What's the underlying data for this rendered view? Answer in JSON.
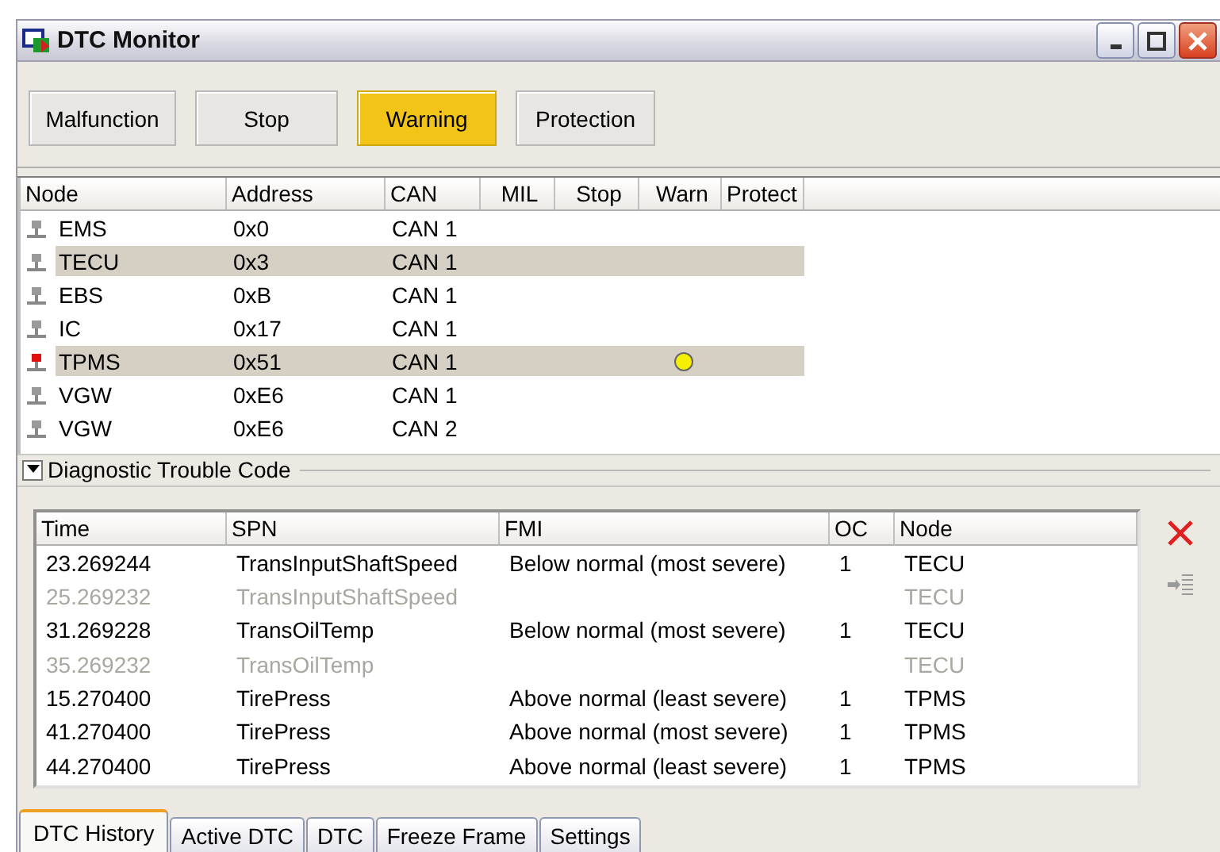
{
  "window": {
    "title": "DTC Monitor"
  },
  "status_buttons": [
    {
      "label": "Malfunction",
      "active": false
    },
    {
      "label": "Stop",
      "active": false
    },
    {
      "label": "Warning",
      "active": true
    },
    {
      "label": "Protection",
      "active": false
    }
  ],
  "nodes": {
    "columns": [
      "Node",
      "Address",
      "CAN",
      "MIL",
      "Stop",
      "Warn",
      "Protect"
    ],
    "rows": [
      {
        "node": "EMS",
        "address": "0x0",
        "can": "CAN 1",
        "selected": false,
        "fault": false,
        "mil": false,
        "stop": false,
        "warn": false,
        "protect": false
      },
      {
        "node": "TECU",
        "address": "0x3",
        "can": "CAN 1",
        "selected": true,
        "fault": false,
        "mil": false,
        "stop": false,
        "warn": false,
        "protect": false
      },
      {
        "node": "EBS",
        "address": "0xB",
        "can": "CAN 1",
        "selected": false,
        "fault": false,
        "mil": false,
        "stop": false,
        "warn": false,
        "protect": false
      },
      {
        "node": "IC",
        "address": "0x17",
        "can": "CAN 1",
        "selected": false,
        "fault": false,
        "mil": false,
        "stop": false,
        "warn": false,
        "protect": false
      },
      {
        "node": "TPMS",
        "address": "0x51",
        "can": "CAN 1",
        "selected": true,
        "fault": true,
        "mil": false,
        "stop": false,
        "warn": true,
        "protect": false
      },
      {
        "node": "VGW",
        "address": "0xE6",
        "can": "CAN 1",
        "selected": false,
        "fault": false,
        "mil": false,
        "stop": false,
        "warn": false,
        "protect": false
      },
      {
        "node": "VGW",
        "address": "0xE6",
        "can": "CAN 2",
        "selected": false,
        "fault": false,
        "mil": false,
        "stop": false,
        "warn": false,
        "protect": false
      }
    ]
  },
  "dtc_group": {
    "title": "Diagnostic Trouble Code",
    "expanded": true
  },
  "dtc": {
    "columns": [
      "Time",
      "SPN",
      "FMI",
      "OC",
      "Node"
    ],
    "rows": [
      {
        "time": "23.269244",
        "spn": "TransInputShaftSpeed",
        "fmi": "Below normal (most severe)",
        "oc": "1",
        "node": "TECU",
        "inactive": false
      },
      {
        "time": "25.269232",
        "spn": "TransInputShaftSpeed",
        "node": "TECU",
        "inactive": true
      },
      {
        "time": "31.269228",
        "spn": "TransOilTemp",
        "fmi": "Below normal (most severe)",
        "oc": "1",
        "node": "TECU",
        "inactive": false
      },
      {
        "time": "35.269232",
        "spn": "TransOilTemp",
        "node": "TECU",
        "inactive": true
      },
      {
        "time": "15.270400",
        "spn": "TirePress",
        "fmi": "Above normal (least severe)",
        "oc": "1",
        "node": "TPMS",
        "inactive": false
      },
      {
        "time": "41.270400",
        "spn": "TirePress",
        "fmi": "Above normal (most severe)",
        "oc": "1",
        "node": "TPMS",
        "inactive": false
      },
      {
        "time": "44.270400",
        "spn": "TirePress",
        "fmi": "Above normal (least severe)",
        "oc": "1",
        "node": "TPMS",
        "inactive": false
      }
    ]
  },
  "tabs": [
    {
      "label": "DTC History",
      "selected": true
    },
    {
      "label": "Active DTC",
      "selected": false
    },
    {
      "label": "DTC",
      "selected": false
    },
    {
      "label": "Freeze Frame",
      "selected": false
    },
    {
      "label": "Settings",
      "selected": false
    }
  ]
}
